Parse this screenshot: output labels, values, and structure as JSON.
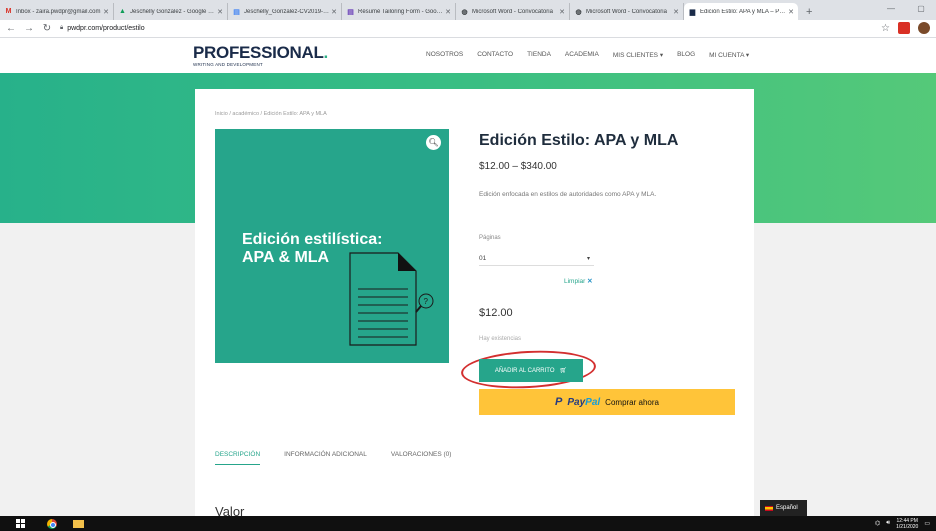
{
  "browser": {
    "tabs": [
      {
        "title": "Inbox - zaira.pwdpr@gmail.com",
        "icon": "gmail-icon",
        "color": "#d93025",
        "glyph": "M"
      },
      {
        "title": "Jeschelly Gonzalez - Google Drive",
        "icon": "drive-icon",
        "color": "#0f9d58",
        "glyph": "▲"
      },
      {
        "title": "Jeschelly_Gonzalez-CV2019-Adm",
        "icon": "docs-icon",
        "color": "#4285f4",
        "glyph": "▤"
      },
      {
        "title": "Résumé Tailoring Form - Google",
        "icon": "forms-icon",
        "color": "#673ab7",
        "glyph": "▤"
      },
      {
        "title": "Microsoft Word - Convocatoria",
        "icon": "globe-icon",
        "color": "#5f6368",
        "glyph": "◍"
      },
      {
        "title": "Microsoft Word - Convocatoria",
        "icon": "globe-icon",
        "color": "#5f6368",
        "glyph": "◍"
      },
      {
        "title": "Edición Estilo: APA y MLA – Profe",
        "icon": "pwd-icon",
        "color": "#1a2b49",
        "glyph": "▆"
      }
    ],
    "new_tab": "+",
    "url": "pwdpr.com/product/estilo"
  },
  "site": {
    "logo_main": "PROFESSIONAL",
    "logo_dot": ".",
    "logo_sub": "WRITING AND DEVELOPMENT",
    "nav": [
      "NOSOTROS",
      "CONTACTO",
      "TIENDA",
      "ACADEMIA",
      "MIS CLIENTES ▾",
      "BLOG",
      "MI CUENTA ▾"
    ]
  },
  "product": {
    "breadcrumb": "Inicio / académico / Edición Estilo: APA y MLA",
    "image_title_line1": "Edición estilística:",
    "image_title_line2": "APA & MLA",
    "title": "Edición Estilo: APA y MLA",
    "price_range": "$12.00 – $340.00",
    "description": "Edición enfocada en estilos de autoridades como APA y MLA.",
    "variation_label": "Páginas",
    "variation_value": "01",
    "clear_label": "Limpiar",
    "clear_x": "✕",
    "variation_price": "$12.00",
    "stock": "Hay existencias",
    "add_to_cart": "AÑADIR AL CARRITO",
    "paypal_pay": "Pay",
    "paypal_pal": "Pal",
    "paypal_cta": "Comprar ahora"
  },
  "tabs": [
    "DESCRIPCIÓN",
    "INFORMACIÓN ADICIONAL",
    "VALORACIONES (0)"
  ],
  "section_title": "Valor",
  "language": "Español",
  "taskbar": {
    "time": "12:44 PM",
    "date": "1/21/2020"
  },
  "colors": {
    "accent": "#26a58b",
    "highlight_circle": "#d32f2f",
    "paypal": "#ffc439"
  }
}
